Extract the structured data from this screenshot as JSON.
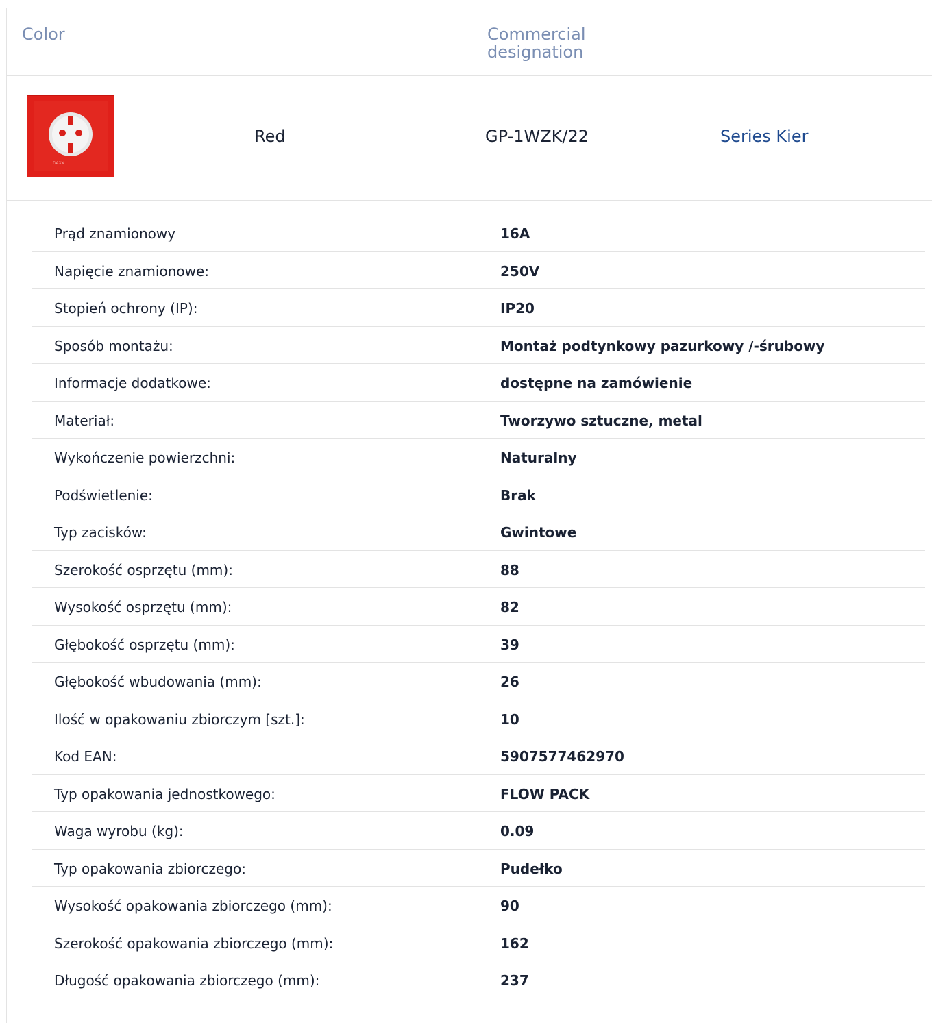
{
  "header": {
    "color_label": "Color",
    "commercial_label": "Commercial designation"
  },
  "product": {
    "image_icon": "socket-red-icon",
    "brand_mark": "DAXX",
    "color": "Red",
    "designation": "GP-1WZK/22",
    "series": "Series Kier",
    "colors": {
      "thumb": "#e0201a",
      "series_link": "#1f4a8f",
      "header_text": "#7a8eb3"
    }
  },
  "specs": [
    {
      "label": "Prąd znamionowy",
      "value": "16A"
    },
    {
      "label": "Napięcie znamionowe:",
      "value": "250V"
    },
    {
      "label": "Stopień ochrony (IP):",
      "value": "IP20"
    },
    {
      "label": "Sposób montażu:",
      "value": "Montaż podtynkowy pazurkowy /-śrubowy"
    },
    {
      "label": "Informacje dodatkowe:",
      "value": "dostępne na zamówienie"
    },
    {
      "label": "Materiał:",
      "value": "Tworzywo sztuczne, metal"
    },
    {
      "label": "Wykończenie powierzchni:",
      "value": "Naturalny"
    },
    {
      "label": "Podświetlenie:",
      "value": "Brak"
    },
    {
      "label": "Typ zacisków:",
      "value": "Gwintowe"
    },
    {
      "label": "Szerokość osprzętu (mm):",
      "value": "88"
    },
    {
      "label": "Wysokość osprzętu (mm):",
      "value": "82"
    },
    {
      "label": "Głębokość osprzętu (mm):",
      "value": "39"
    },
    {
      "label": "Głębokość wbudowania (mm):",
      "value": "26"
    },
    {
      "label": "Ilość w opakowaniu zbiorczym [szt.]:",
      "value": "10"
    },
    {
      "label": "Kod EAN:",
      "value": "5907577462970"
    },
    {
      "label": "Typ opakowania jednostkowego:",
      "value": "FLOW PACK"
    },
    {
      "label": "Waga wyrobu (kg):",
      "value": "0.09"
    },
    {
      "label": "Typ opakowania zbiorczego:",
      "value": "Pudełko"
    },
    {
      "label": "Wysokość opakowania zbiorczego (mm):",
      "value": "90"
    },
    {
      "label": "Szerokość opakowania zbiorczego (mm):",
      "value": "162"
    },
    {
      "label": "Długość opakowania zbiorczego (mm):",
      "value": "237"
    }
  ]
}
